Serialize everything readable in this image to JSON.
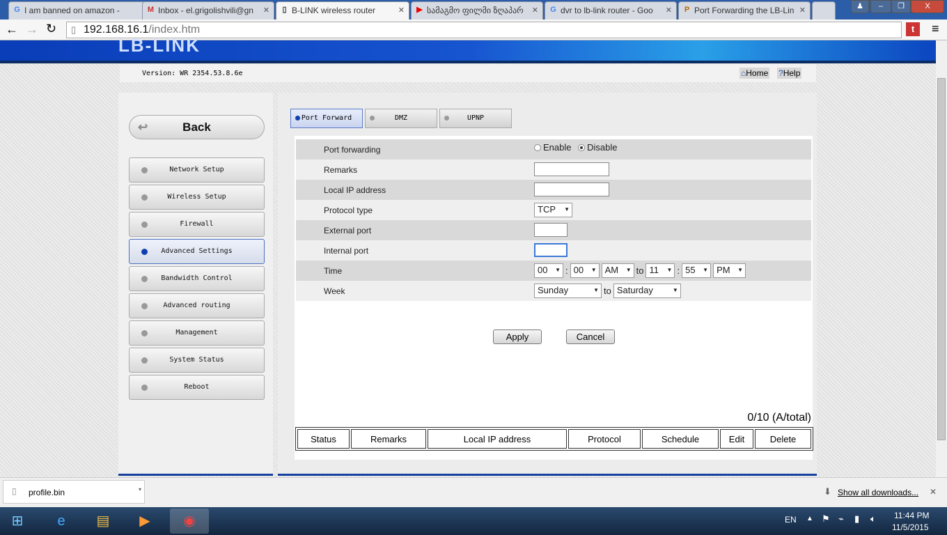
{
  "browser": {
    "tabs": [
      {
        "title": "I am banned on amazon -",
        "icon": "google-icon"
      },
      {
        "title": "Inbox - el.grigolishvili@gn",
        "icon": "gmail-icon"
      },
      {
        "title": "B-LINK wireless router",
        "icon": "page-icon"
      },
      {
        "title": "სამაგმო ფილმი ზღაპარ",
        "icon": "youtube-icon"
      },
      {
        "title": "dvr to lb-link router - Goo",
        "icon": "google-icon"
      },
      {
        "title": "Port Forwarding the LB-Lin",
        "icon": "pf-icon"
      }
    ],
    "url_host": "192.168.16.1",
    "url_path": "/index.htm"
  },
  "router": {
    "logo": "LB-LINK",
    "version": "Version: WR 2354.53.8.6e",
    "home": "Home",
    "help": "Help",
    "back": "Back",
    "nav": [
      "Network Setup",
      "Wireless Setup",
      "Firewall",
      "Advanced Settings",
      "Bandwidth Control",
      "Advanced routing",
      "Management",
      "System Status",
      "Reboot"
    ],
    "active_nav": "Advanced Settings",
    "subtabs": [
      "Port Forward",
      "DMZ",
      "UPNP"
    ],
    "form": {
      "port_forwarding": {
        "label": "Port forwarding",
        "options": [
          "Enable",
          "Disable"
        ],
        "selected": "Disable"
      },
      "remarks": {
        "label": "Remarks",
        "value": ""
      },
      "local_ip": {
        "label": "Local IP address",
        "value": ""
      },
      "protocol": {
        "label": "Protocol type",
        "value": "TCP"
      },
      "external_port": {
        "label": "External port",
        "value": ""
      },
      "internal_port": {
        "label": "Internal port",
        "value": ""
      },
      "time": {
        "label": "Time",
        "start_h": "00",
        "start_m": "00",
        "start_ampm": "AM",
        "to": "to",
        "end_h": "11",
        "end_m": "55",
        "end_ampm": "PM",
        "sep": ":"
      },
      "week": {
        "label": "Week",
        "from": "Sunday",
        "to_label": "to",
        "to": "Saturday"
      }
    },
    "apply": "Apply",
    "cancel": "Cancel",
    "count": "0/10 (A/total)",
    "columns": [
      "Status",
      "Remarks",
      "Local IP address",
      "Protocol",
      "Schedule",
      "Edit",
      "Delete"
    ]
  },
  "downloads": {
    "file": "profile.bin",
    "show_all": "Show all downloads..."
  },
  "taskbar": {
    "lang": "EN",
    "time": "11:44 PM",
    "date": "11/5/2015"
  }
}
